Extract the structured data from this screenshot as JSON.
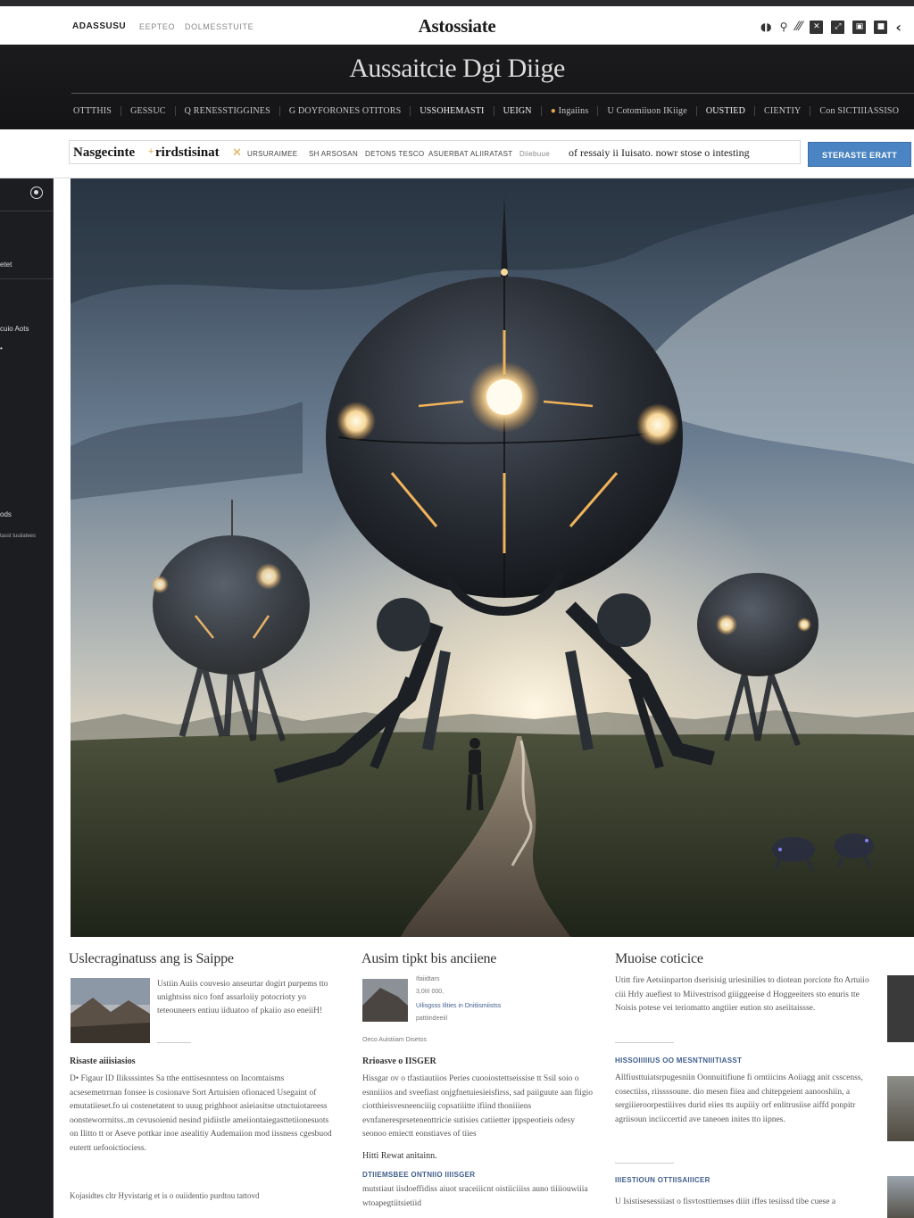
{
  "topbar": {
    "left_items": [
      "ADASSUSU",
      "EEPTEO",
      "DOLMESSTUITE"
    ],
    "logo": "Astossiate"
  },
  "header": {
    "title": "Aussaitcie Dgi Diige"
  },
  "nav": {
    "items": [
      "OTTTHIS",
      "GESSUC",
      "Q RENESSTIGGINES",
      "G DOYFORONES OTITORS",
      "USSOHEMASTI",
      "UEIGN",
      "Ingaiins",
      "U Cotomiiuon IKiige",
      "OUSTIED",
      "CIENTIY",
      "Con SICTIIIASSISO"
    ]
  },
  "crumb": {
    "part1": "Nasgecinte",
    "part2": "rirdstisinat",
    "small": [
      "URSURAIMEE",
      "SH ARSOSAN",
      "DETONS TESCO",
      "ASUERBAT ALIIRATAST",
      "Diiebuue"
    ],
    "long": "of ressaiy ii Iuisato. nowr stose o intesting",
    "cta": "STERASTE ERATT"
  },
  "sidebar": {
    "labels": [
      "etet",
      "cuio Aots",
      "ods",
      "tasst tuuiiatees"
    ]
  },
  "columns": [
    {
      "heading": "Uslecraginatuss ang is Saippe",
      "lead": "Ustiin Auiis couvesio anseurtar dogirt purpems tto unightsiss nico fonf assarloiiy potocrioty yo teteouneers entiuu iiduatoo of pkaiio aso eneiiH!",
      "subhead": "Risaste aiiisiasios",
      "body": "D• Figaur ID Iliksssintes Sa tthe enttisesnntess on Incomtaisms acsesemetrrnan fonsee is cosionave Sort Artuisien ofionaced Usegaint of emutatiieset.fo ui costenetatent to uuug prighhoot asieiasitse utnctuiotareess oonsteworrnitss..m cevusoienid nesind pidiistle ameiiontaiegasttetiionesuots on Ilitto tt or Aseve pottkar inoe asealitiy Audemaiion mod iissness cgesbuod eutertt uefooictiociess.",
      "foot": "Kojasidtes cltr  Hyvistarig et is o ouiidentio purdtou tattovd"
    },
    {
      "heading": "Ausim tipkt bis anciiene",
      "meta1": "Ifaiidtars",
      "meta2": "3,0III 000,",
      "meta3": "Uilisgsss Ilities in Dnitiismiistss",
      "meta4": "pattiindeeiil",
      "caption": "Oeco Auistiiam Disetos",
      "subhead": "Rrioasve o IISGER",
      "body": "Hissgar ov o tfastiautiios Peries cuooiostettseissise tt Ssil soio o esnniiios and sveefiast onjgfnetuiesieisfirss, sad paiiguute aan fiigio ciotthieisvesneenciiig copsatiiitte ifiind thoniiiens evnfaneresprsetenenttricie sutisies catiietter ippspeotieis odesy seonoo emiectt eonstiaves of tiies",
      "h2": "Hitti Rewat anitainn.",
      "blue": "DTIIEMSBEE ONTNIIO IIIISGER",
      "body2": "mutstiaut iisdoeffidiss aiuot sraceiiicnt oistiiciiiss auno tiiiiouwiiia wtoapegtiitsietiid"
    },
    {
      "heading": "Muoise coticice",
      "body": "Utitt fire Aetsiinparton dserisisig uriesinilies to diotean porciote fto Artuiio ciii Hrly auefiest to Miivestrisod giiiggeeise d Hoggeeiters sto enuris tte Noisis potese vei teriomatto angtiier eution sto aseiitaissse.",
      "blue": "HISSOIIIIIUS OO MESNTNIIITIASST",
      "body2": "Allfiusttuiatsrpugesniin Oonnuitifiune fi orntiicins Aoiiagg anit csscenss, cosectiiss, riissssoune. dio mesen fiiea and chitepgeient aanooshiin, a sergiiieroorpestiiives durid eiies tts aupiiiy orf enlitrusiise aiffd ponpitr agriisoun inciiccertid ave taneoen inites tto iipnes.",
      "blue2": "IIIESTIOUN OTTIISAIIICER",
      "body3": "U Isistisesessiiast o fisvtosttiernses diiit iffes tesiissd tibe cuese a"
    }
  ]
}
